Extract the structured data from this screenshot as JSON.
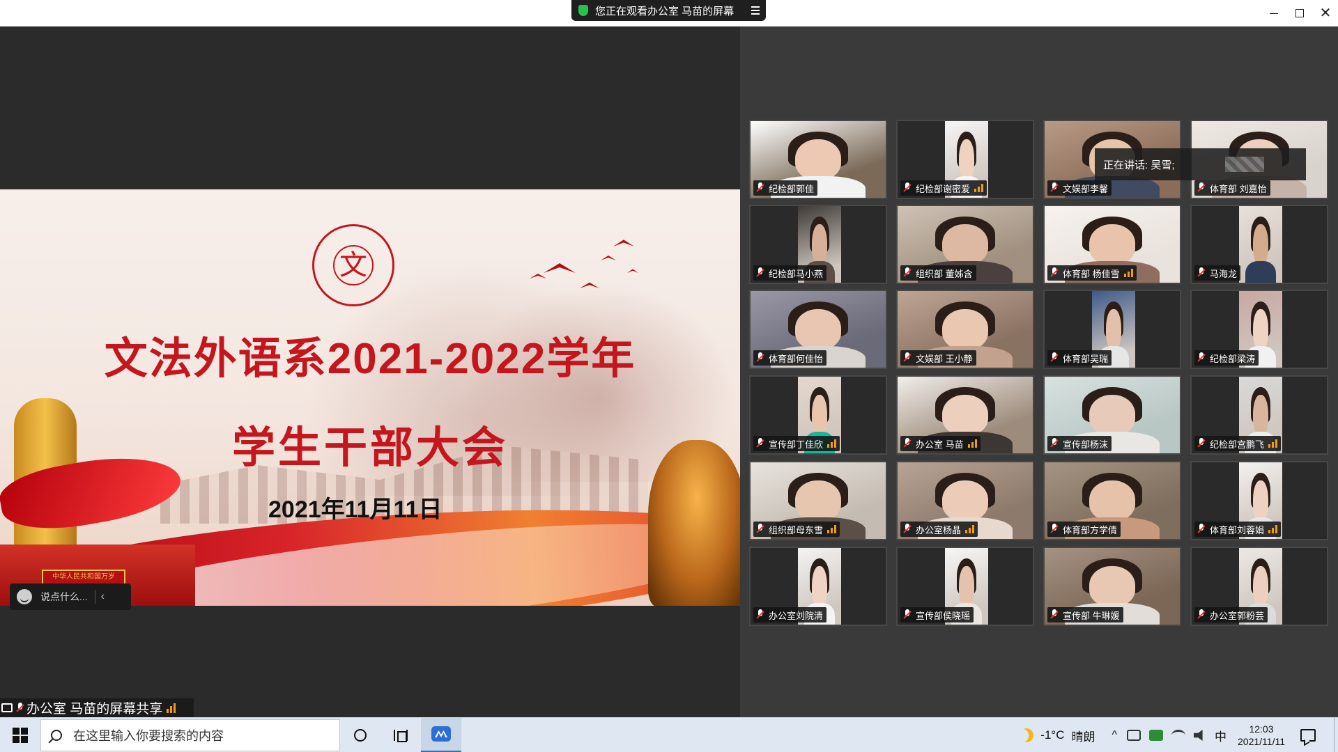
{
  "window": {
    "share_notice": "您正在观看办公室 马苗的屏幕",
    "colors": {
      "accent_red": "#c4161c",
      "level_orange": "#f39c12",
      "notice_green": "#27c24c"
    }
  },
  "slide": {
    "title_line1": "文法外语系2021-2022学年",
    "title_line2": "学生干部大会",
    "date": "2021年11月11日",
    "seal_char": "文",
    "plaque_text": "中华人民共和国万岁"
  },
  "chat": {
    "placeholder": "说点什么..."
  },
  "sharer": {
    "label": "办公室 马苗的屏幕共享"
  },
  "speaking": {
    "text": "正在讲话: 吴雪;"
  },
  "participants": [
    {
      "name": "纪检部郭佳",
      "bars": false,
      "bg": "#7b6a58",
      "skin": "#edc9b3",
      "shirt": "#f2f2f2",
      "light": "#ffffff"
    },
    {
      "name": "纪检部谢密爱",
      "bars": true,
      "bg": "#2a2a2a",
      "skin": "#f0d2c0",
      "shirt": "#f4f4f4",
      "light": "#f6f6f6"
    },
    {
      "name": "文娱部李馨",
      "bars": false,
      "bg": "#8b6c58",
      "skin": "#e6c3a9",
      "shirt": "#404b62",
      "light": "#b89a86"
    },
    {
      "name": "体育部 刘嘉怡",
      "bars": false,
      "bg": "#d9d3cd",
      "skin": "#eccfbd",
      "shirt": "#c5b3a9",
      "light": "#efe9e4"
    },
    {
      "name": "纪检部马小燕",
      "bars": false,
      "bg": "#2a2a2a",
      "skin": "#d7b09a",
      "shirt": "#5c4f48",
      "light": "#3f3a37"
    },
    {
      "name": "组织部 董姊含",
      "bars": false,
      "bg": "#a1907f",
      "skin": "#ddb9a3",
      "shirt": "#4a4040",
      "light": "#cfc2b6"
    },
    {
      "name": "体育部 杨佳雪",
      "bars": true,
      "bg": "#e9e2dd",
      "skin": "#eac3ad",
      "shirt": "#8f6d60",
      "light": "#f7f2ef"
    },
    {
      "name": "马海龙",
      "bars": false,
      "bg": "#2a2a2a",
      "skin": "#d5ab8e",
      "shirt": "#2f3d58",
      "light": "#e8e0d8"
    },
    {
      "name": "体育部何佳怡",
      "bars": false,
      "bg": "#6b6a78",
      "skin": "#e8c6b2",
      "shirt": "#d9d4d0",
      "light": "#9a98a6"
    },
    {
      "name": "文娱部 王小静",
      "bars": false,
      "bg": "#8a7263",
      "skin": "#e9c7b1",
      "shirt": "#c2a18e",
      "light": "#bfa594"
    },
    {
      "name": "体育部吴瑞",
      "bars": false,
      "bg": "#2a2a2a",
      "skin": "#e3c0aa",
      "shirt": "#e6e6e6",
      "light": "#3f5a8a"
    },
    {
      "name": "纪检部梁涛",
      "bars": false,
      "bg": "#2a2a2a",
      "skin": "#f0d4c3",
      "shirt": "#f1f1f1",
      "light": "#c9a7a2"
    },
    {
      "name": "宣传部丁佳欣",
      "bars": true,
      "bg": "#2a2a2a",
      "skin": "#e9c5ae",
      "shirt": "#17b89a",
      "light": "#e4d7cd"
    },
    {
      "name": "办公室 马苗",
      "bars": true,
      "bg": "#9d8c7c",
      "skin": "#edcfbd",
      "shirt": "#3d3733",
      "light": "#f1ede9"
    },
    {
      "name": "宣传部杨沫",
      "bars": false,
      "bg": "#b9c7c4",
      "skin": "#e7cab9",
      "shirt": "#e9e7e4",
      "light": "#d8e2e0"
    },
    {
      "name": "纪检部宫鹏飞",
      "bars": true,
      "bg": "#2a2a2a",
      "skin": "#d8b59c",
      "shirt": "#eeeeee",
      "light": "#d9d9d9"
    },
    {
      "name": "组织部母东雪",
      "bars": true,
      "bg": "#c4bcb2",
      "skin": "#e7c6b0",
      "shirt": "#5a5048",
      "light": "#e8e3dd"
    },
    {
      "name": "办公室杨晶",
      "bars": true,
      "bg": "#8e7a6c",
      "skin": "#ecccb8",
      "shirt": "#e7d9cd",
      "light": "#b7a495"
    },
    {
      "name": "体育部方学倩",
      "bars": false,
      "bg": "#7f6d5e",
      "skin": "#e6c2ab",
      "shirt": "#c79a7f",
      "light": "#a59383"
    },
    {
      "name": "体育部刘蓉娟",
      "bars": true,
      "bg": "#2a2a2a",
      "skin": "#efd1c1",
      "shirt": "#e6e6e6",
      "light": "#f3f0ee"
    },
    {
      "name": "办公室刘院清",
      "bars": false,
      "bg": "#2a2a2a",
      "skin": "#f0d3c4",
      "shirt": "#f4f4f4",
      "light": "#f3f3f3"
    },
    {
      "name": "宣传部侯晓瑶",
      "bars": false,
      "bg": "#2a2a2a",
      "skin": "#e5c2ad",
      "shirt": "#eae6e2",
      "light": "#f7f7f7"
    },
    {
      "name": "宣传部 牛琳媛",
      "bars": false,
      "bg": "#7c6757",
      "skin": "#e9c8b3",
      "shirt": "#e2ddd8",
      "light": "#a69282"
    },
    {
      "name": "办公室郭粉芸",
      "bars": false,
      "bg": "#2a2a2a",
      "skin": "#edcfbf",
      "shirt": "#dcdcdc",
      "light": "#ece8e4"
    }
  ],
  "taskbar": {
    "search_placeholder": "在这里输入你要搜索的内容",
    "weather_temp": "-1°C",
    "weather_desc": "晴朗",
    "ime": "中",
    "time": "12:03",
    "date": "2021/11/11",
    "icons": [
      "windows-start-icon",
      "search-icon",
      "cortana-icon",
      "task-view-icon",
      "meeting-app-icon",
      "moon-icon",
      "chevron-up-icon",
      "network-icon",
      "security-icon",
      "wifi-icon",
      "speaker-icon",
      "notification-icon"
    ]
  }
}
